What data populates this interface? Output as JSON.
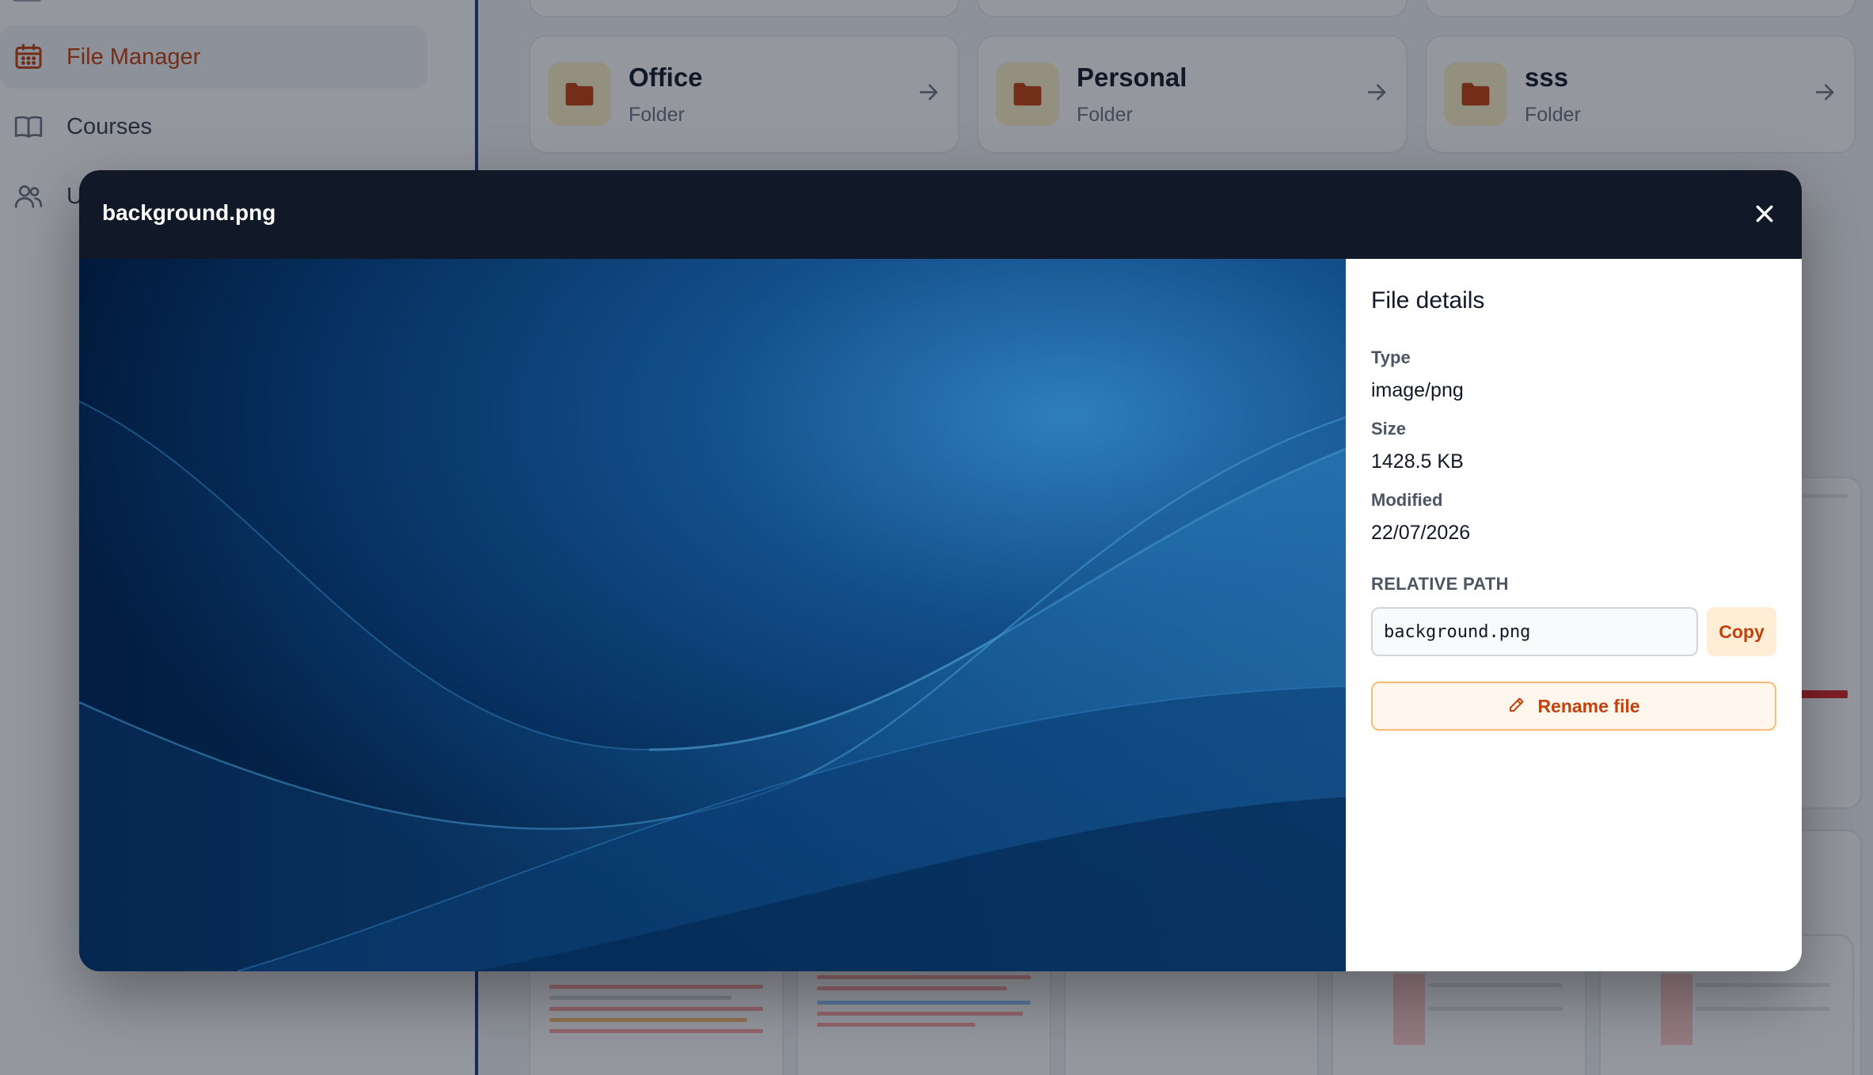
{
  "sidebar": {
    "items": [
      {
        "label": "File Manager",
        "icon": "calendar-grid-icon",
        "active": true
      },
      {
        "label": "Courses",
        "icon": "book-icon",
        "active": false
      },
      {
        "label": "U",
        "icon": "users-icon",
        "active": false
      }
    ]
  },
  "folders": [
    {
      "name": "Office",
      "type": "Folder"
    },
    {
      "name": "Personal",
      "type": "Folder"
    },
    {
      "name": "sss",
      "type": "Folder"
    }
  ],
  "modal": {
    "title": "background.png",
    "details": {
      "heading": "File details",
      "type_label": "Type",
      "type_value": "image/png",
      "size_label": "Size",
      "size_value": "1428.5 KB",
      "modified_label": "Modified",
      "modified_value": "22/07/2026",
      "path_label": "RELATIVE PATH",
      "path_value": "background.png",
      "copy_label": "Copy",
      "rename_label": "Rename file"
    }
  },
  "colors": {
    "accent": "#c2410c",
    "header_bg": "#111827",
    "folder_icon": "#c2410c",
    "folder_icon_bg": "#fef3c7"
  }
}
